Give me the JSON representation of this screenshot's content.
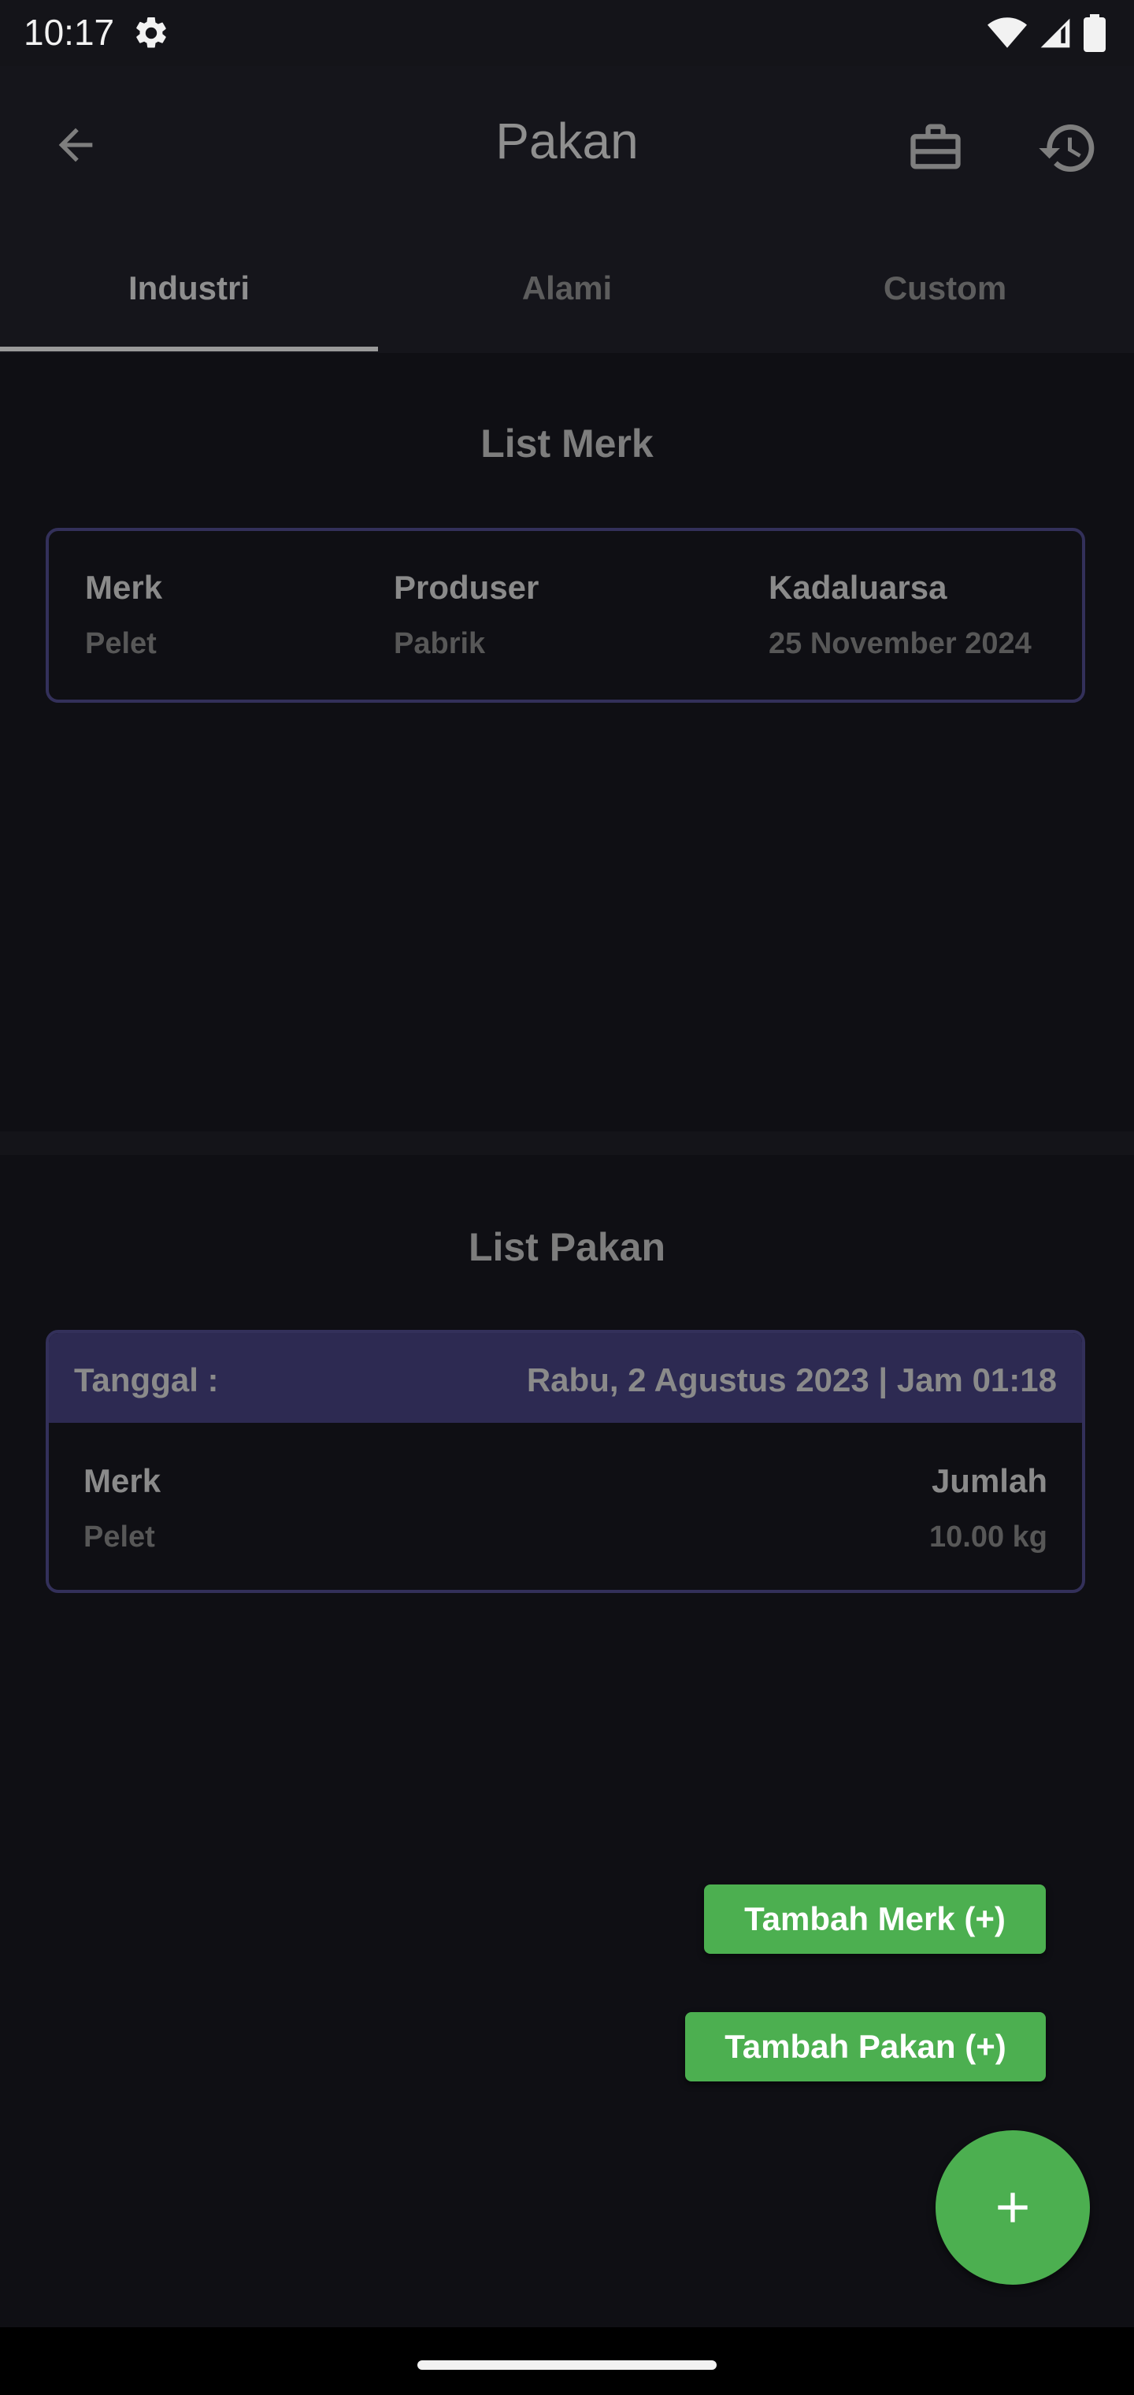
{
  "status_bar": {
    "time": "10:17",
    "icons": [
      "gear-icon",
      "wifi-icon",
      "signal-icon",
      "battery-icon"
    ]
  },
  "app_bar": {
    "title": "Pakan",
    "icons": [
      "arrow-back-icon",
      "briefcase-icon",
      "history-icon"
    ]
  },
  "tabs": [
    {
      "label": "Industri",
      "active": true
    },
    {
      "label": "Alami",
      "active": false
    },
    {
      "label": "Custom",
      "active": false
    }
  ],
  "list_merk": {
    "title": "List Merk",
    "item": {
      "merk_label": "Merk",
      "merk_value": "Pelet",
      "produser_label": "Produser",
      "produser_value": "Pabrik",
      "kadaluarsa_label": "Kadaluarsa",
      "kadaluarsa_value": "25 November 2024"
    }
  },
  "list_pakan": {
    "title": "List Pakan",
    "item": {
      "tanggal_label": "Tanggal :",
      "tanggal_value": "Rabu, 2 Agustus 2023 | Jam 01:18",
      "merk_label": "Merk",
      "merk_value": "Pelet",
      "jumlah_label": "Jumlah",
      "jumlah_value": "10.00 kg"
    }
  },
  "actions": {
    "tambah_merk": "Tambah Merk (+)",
    "tambah_pakan": "Tambah Pakan (+)",
    "fab_icon": "plus-icon"
  },
  "colors": {
    "accent_green": "#4caf50",
    "card_border": "#33305a",
    "card_header": "#2d2a52",
    "background": "#0f0f14"
  }
}
